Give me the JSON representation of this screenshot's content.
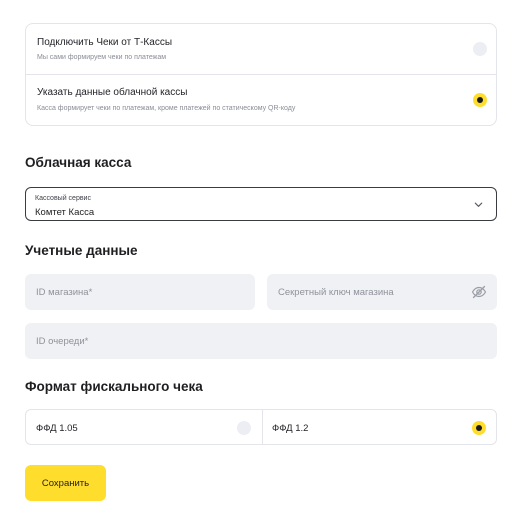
{
  "receipt_source": {
    "options": [
      {
        "title": "Подключить Чеки от Т-Кассы",
        "subtitle": "Мы сами формируем чеки по платежам",
        "selected": false
      },
      {
        "title": "Указать данные облачной кассы",
        "subtitle": "Касса формирует чеки по платежам, кроме платежей по статическому QR-коду",
        "selected": true
      }
    ]
  },
  "cloud_register": {
    "heading": "Облачная касса",
    "service_select": {
      "label": "Кассовый сервис",
      "value": "Комтет Касса",
      "icon": "chevron-down-icon"
    }
  },
  "credentials": {
    "heading": "Учетные данные",
    "shop_id": {
      "placeholder": "ID магазина*",
      "value": ""
    },
    "secret_key": {
      "placeholder": "Секретный ключ магазина",
      "value": "",
      "icon": "eye-off-icon"
    },
    "queue_id": {
      "placeholder": "ID очереди*",
      "value": ""
    }
  },
  "fiscal_format": {
    "heading": "Формат фискального чека",
    "options": [
      {
        "label": "ФФД 1.05",
        "selected": false
      },
      {
        "label": "ФФД 1.2",
        "selected": true
      }
    ]
  },
  "actions": {
    "save_label": "Сохранить"
  },
  "colors": {
    "accent": "#ffdd2d",
    "radio_off": "#eceef3",
    "input_bg": "#f0f1f4",
    "border": "#e4e5ea"
  }
}
